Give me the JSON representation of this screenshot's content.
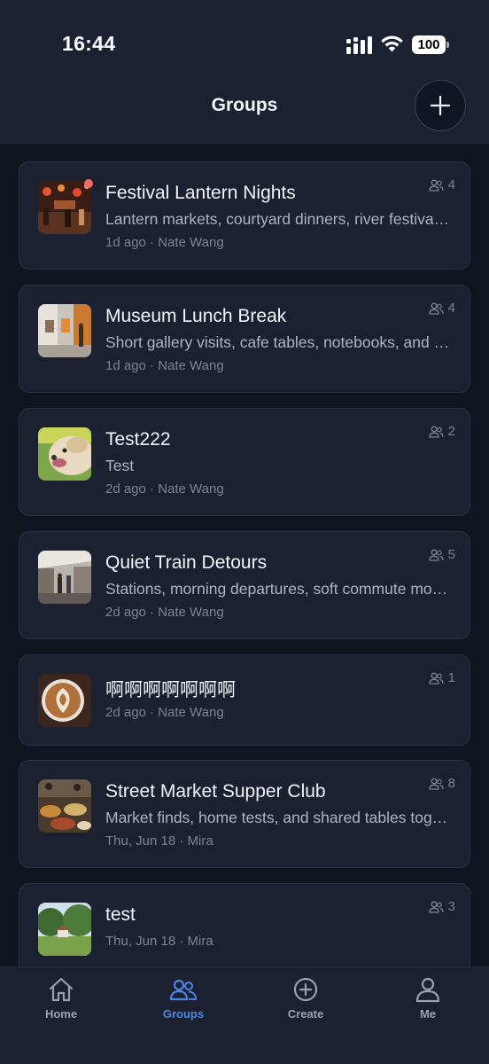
{
  "status_bar": {
    "time": "16:44",
    "battery": "100"
  },
  "header": {
    "title": "Groups"
  },
  "groups": [
    {
      "title": "Festival Lantern Nights",
      "description": "Lantern markets, courtyard dinners, river festival walks",
      "meta": "1d ago · Nate Wang",
      "members": "4",
      "unread": true,
      "thumb": "lantern-market-photo"
    },
    {
      "title": "Museum Lunch Break",
      "description": "Short gallery visits, cafe tables, notebooks, and quiet halls",
      "meta": "1d ago · Nate Wang",
      "members": "4",
      "unread": false,
      "thumb": "museum-gallery-photo"
    },
    {
      "title": "Test222",
      "description": "Test",
      "meta": "2d ago · Nate Wang",
      "members": "2",
      "unread": false,
      "thumb": "dog-photo"
    },
    {
      "title": "Quiet Train Detours",
      "description": "Stations, morning departures, soft commute moments",
      "meta": "2d ago · Nate Wang",
      "members": "5",
      "unread": false,
      "thumb": "train-station-photo"
    },
    {
      "title": "啊啊啊啊啊啊啊",
      "description": "",
      "meta": "2d ago · Nate Wang",
      "members": "1",
      "unread": false,
      "thumb": "latte-art-photo"
    },
    {
      "title": "Street Market Supper Club",
      "description": "Market finds, home tests, and shared tables together",
      "meta": "Thu, Jun 18 · Mira",
      "members": "8",
      "unread": false,
      "thumb": "street-food-photo"
    },
    {
      "title": "test",
      "description": "",
      "meta": "Thu, Jun 18 · Mira",
      "members": "3",
      "unread": false,
      "thumb": "park-photo"
    }
  ],
  "tabs": [
    {
      "label": "Home",
      "icon": "home-icon",
      "active": false
    },
    {
      "label": "Groups",
      "icon": "groups-icon",
      "active": true
    },
    {
      "label": "Create",
      "icon": "create-icon",
      "active": false
    },
    {
      "label": "Me",
      "icon": "profile-icon",
      "active": false
    }
  ],
  "colors": {
    "accent": "#4f86e6",
    "unread_dot": "#ef6b63",
    "card_bg": "#1b2131",
    "page_bg": "#111520"
  }
}
